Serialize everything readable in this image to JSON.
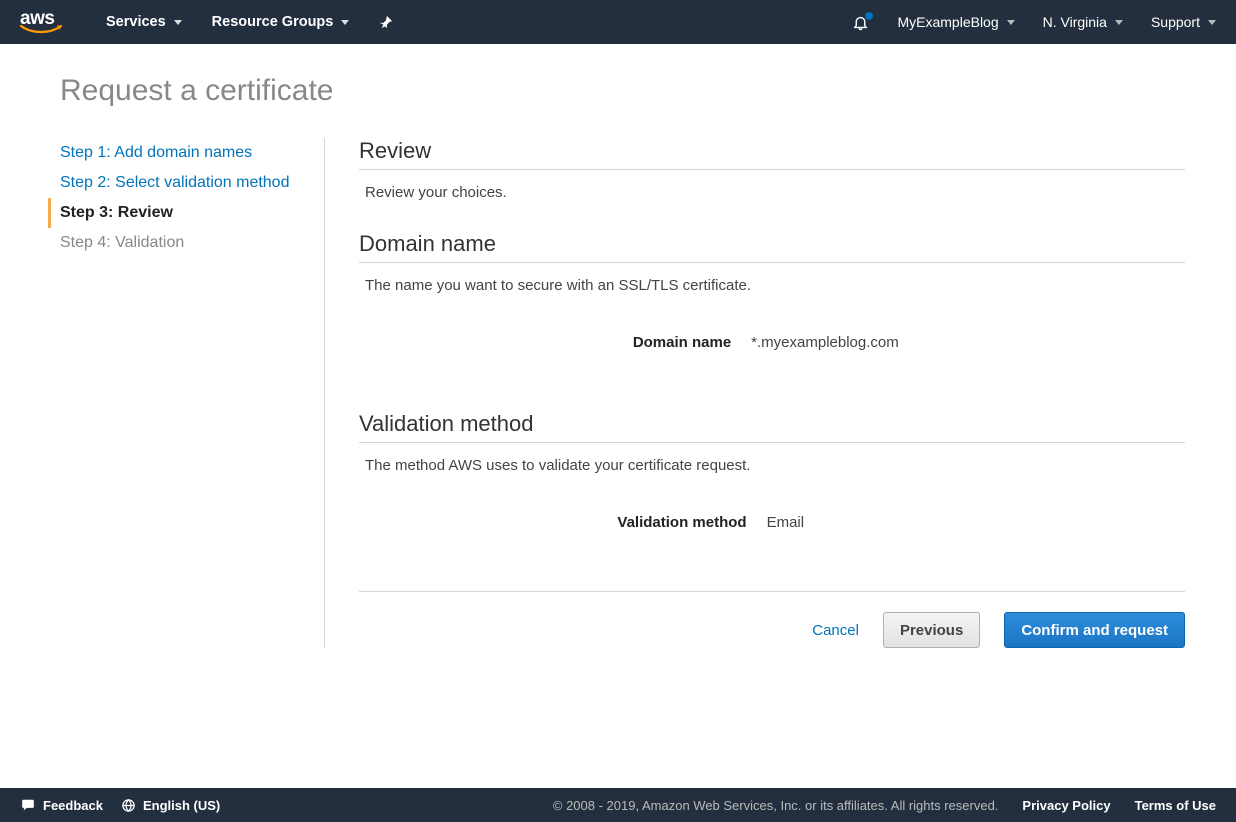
{
  "nav": {
    "services": "Services",
    "resource_groups": "Resource Groups",
    "account": "MyExampleBlog",
    "region": "N. Virginia",
    "support": "Support"
  },
  "page_title": "Request a certificate",
  "steps": [
    {
      "label": "Step 1: Add domain names",
      "state": "done"
    },
    {
      "label": "Step 2: Select validation method",
      "state": "done"
    },
    {
      "label": "Step 3: Review",
      "state": "active"
    },
    {
      "label": "Step 4: Validation",
      "state": "future"
    }
  ],
  "review": {
    "heading": "Review",
    "desc": "Review your choices."
  },
  "domain": {
    "heading": "Domain name",
    "desc": "The name you want to secure with an SSL/TLS certificate.",
    "key": "Domain name",
    "value": "*.myexampleblog.com"
  },
  "validation": {
    "heading": "Validation method",
    "desc": "The method AWS uses to validate your certificate request.",
    "key": "Validation method",
    "value": "Email"
  },
  "actions": {
    "cancel": "Cancel",
    "previous": "Previous",
    "confirm": "Confirm and request"
  },
  "footer": {
    "feedback": "Feedback",
    "language": "English (US)",
    "copyright": "© 2008 - 2019, Amazon Web Services, Inc. or its affiliates. All rights reserved.",
    "privacy": "Privacy Policy",
    "terms": "Terms of Use"
  }
}
